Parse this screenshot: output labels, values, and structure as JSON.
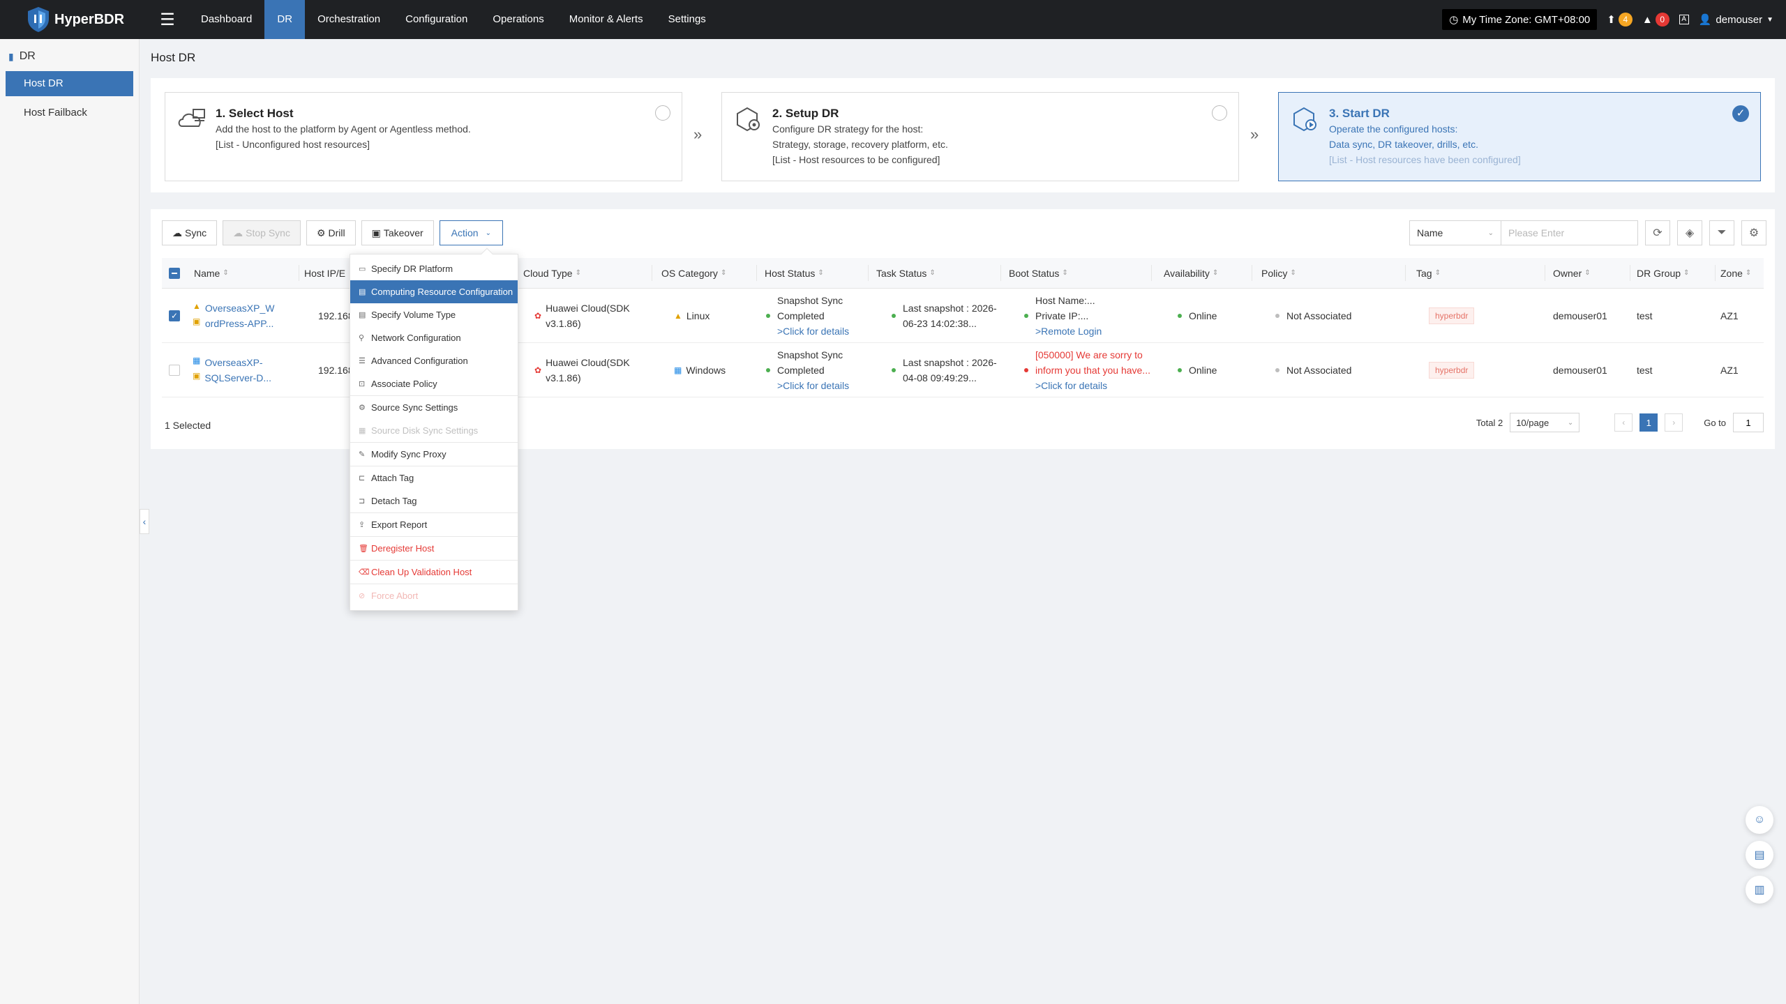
{
  "app": {
    "name": "HyperBDR"
  },
  "nav": {
    "items": [
      "Dashboard",
      "DR",
      "Orchestration",
      "Configuration",
      "Operations",
      "Monitor & Alerts",
      "Settings"
    ],
    "active": "DR"
  },
  "topRight": {
    "timezone": "My Time Zone: GMT+08:00",
    "uploads": "4",
    "alerts": "0",
    "user": "demouser"
  },
  "sidebar": {
    "section": "DR",
    "items": [
      "Host DR",
      "Host Failback"
    ]
  },
  "page": {
    "title": "Host DR"
  },
  "steps": [
    {
      "title": "1. Select Host",
      "lines": [
        "Add the host to the platform by Agent or Agentless method.",
        "[List - Unconfigured host resources]"
      ]
    },
    {
      "title": "2. Setup DR",
      "lines": [
        "Configure DR strategy for the host:",
        "Strategy, storage, recovery platform, etc.",
        "[List - Host resources to be configured]"
      ]
    },
    {
      "title": "3. Start DR",
      "lines": [
        "Operate the configured hosts:",
        "Data sync, DR takeover, drills, etc.",
        "[List - Host resources have been configured]"
      ]
    }
  ],
  "toolbar": {
    "sync": "Sync",
    "stopSync": "Stop Sync",
    "drill": "Drill",
    "takeover": "Takeover",
    "action": "Action"
  },
  "search": {
    "field": "Name",
    "placeholder": "Please Enter"
  },
  "table": {
    "headers": {
      "name": "Name",
      "hostIp": "Host IP/E",
      "cloudType": "Cloud Type",
      "osCategory": "OS Category",
      "hostStatus": "Host Status",
      "taskStatus": "Task Status",
      "bootStatus": "Boot Status",
      "availability": "Availability",
      "policy": "Policy",
      "tag": "Tag",
      "owner": "Owner",
      "drGroup": "DR Group",
      "zone": "Zone"
    },
    "rows": [
      {
        "name1": "OverseasXP_W",
        "name2": "ordPress-APP...",
        "ip": "192.168.1",
        "cloud1": "Huawei Cloud(SDK",
        "cloud2": "v3.1.86)",
        "os": "Linux",
        "host1": "Snapshot Sync",
        "host2": "Completed",
        "host3": ">Click for details",
        "task1": "Last snapshot : 2026-",
        "task2": "06-23 14:02:38...",
        "boot1": "Host Name:...",
        "boot2": "Private IP:...",
        "boot3": ">Remote Login",
        "availability": "Online",
        "policy": "Not Associated",
        "tag": "hyperbdr",
        "owner": "demouser01",
        "group": "test",
        "zone": "AZ1"
      },
      {
        "name1": "OverseasXP-",
        "name2": "SQLServer-D...",
        "ip": "192.168.1",
        "cloud1": "Huawei Cloud(SDK",
        "cloud2": "v3.1.86)",
        "os": "Windows",
        "host1": "Snapshot Sync",
        "host2": "Completed",
        "host3": ">Click for details",
        "task1": "Last snapshot : 2026-",
        "task2": "04-08 09:49:29...",
        "boot1": "[050000] We are sorry to",
        "boot2": "inform you that you have...",
        "boot3": ">Click for details",
        "availability": "Online",
        "policy": "Not Associated",
        "tag": "hyperbdr",
        "owner": "demouser01",
        "group": "test",
        "zone": "AZ1"
      }
    ]
  },
  "footer": {
    "selected": "1 Selected",
    "total": "Total 2",
    "pageSize": "10/page",
    "page": "1",
    "goto": "Go to",
    "gotoValue": "1"
  },
  "actionMenu": {
    "items": [
      "Specify DR Platform",
      "Computing Resource Configuration",
      "Specify Volume Type",
      "Network Configuration",
      "Advanced Configuration",
      "Associate Policy",
      "Source Sync Settings",
      "Source Disk Sync Settings",
      "Modify Sync Proxy",
      "Attach Tag",
      "Detach Tag",
      "Export Report",
      "Deregister Host",
      "Clean Up Validation Host",
      "Force Abort"
    ]
  },
  "colors": {
    "primary": "#3a74b5",
    "topbar": "#1f2124",
    "danger": "#e53935",
    "success": "#4caf50"
  }
}
